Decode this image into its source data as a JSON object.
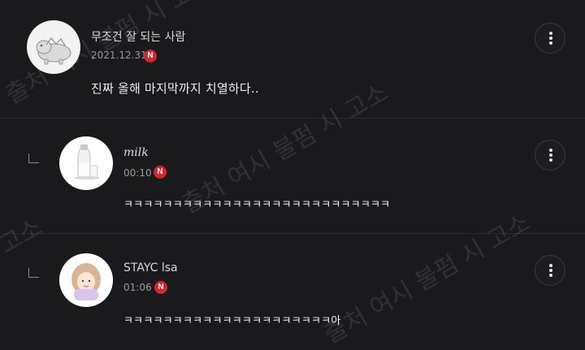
{
  "comments": [
    {
      "nickname": "무조건 잘 되는 사람",
      "time": "2021.12.31",
      "badge": "N",
      "text": "진짜 올해 마지막까지 치열하다.."
    },
    {
      "nickname": "milk",
      "time": "00:10",
      "badge": "N",
      "text": "ㅋㅋㅋㅋㅋㅋㅋㅋㅋㅋㅋㅋㅋㅋㅋㅋㅋㅋㅋㅋㅋㅋㅋㅋㅋㅋㅋ"
    },
    {
      "nickname": "STAYC lsa",
      "time": "01:06",
      "badge": "N",
      "text": "ㅋㅋㅋㅋㅋㅋㅋㅋㅋㅋㅋㅋㅋㅋㅋㅋㅋㅋㅋㅋㅋ아"
    }
  ],
  "watermarks": [
    "출처 여시 불펌 시 고소",
    "출처 여시 불펌 시 고소",
    "출처 여시 불펌 시 고소",
    "고소"
  ]
}
